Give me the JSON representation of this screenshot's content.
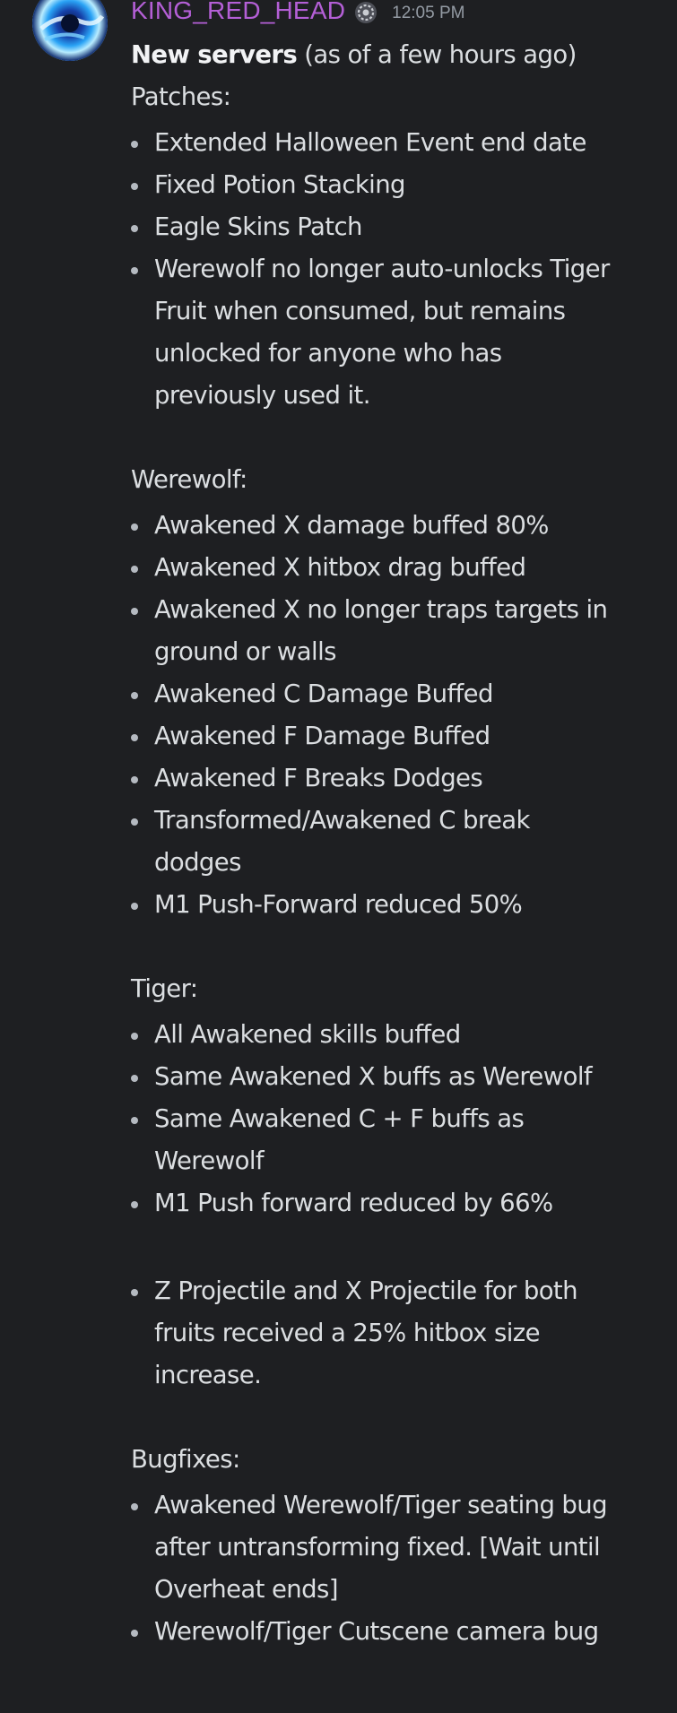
{
  "message": {
    "author": "KING_RED_HEAD",
    "time": "12:05 PM",
    "badge_icon": "gear-badge-icon",
    "author_color": "#b45fd6",
    "intro_bold": "New servers",
    "intro_rest": " (as of a few hours ago)",
    "sections": {
      "patches": {
        "heading": "Patches:",
        "items": [
          [
            "Extended Halloween Event end date"
          ],
          [
            "Fixed Potion Stacking"
          ],
          [
            "Eagle Skins Patch"
          ],
          [
            "Werewolf no longer auto-unlocks Tiger",
            "Fruit when consumed, but remains",
            "unlocked for anyone who has",
            "previously used it."
          ]
        ]
      },
      "werewolf": {
        "heading": "Werewolf:",
        "items": [
          [
            "Awakened X damage buffed 80%"
          ],
          [
            "Awakened X hitbox drag buffed"
          ],
          [
            "Awakened X no longer traps targets in",
            "ground or walls"
          ],
          [
            "Awakened C Damage Buffed"
          ],
          [
            "Awakened F Damage Buffed"
          ],
          [
            "Awakened F Breaks Dodges"
          ],
          [
            "Transformed/Awakened C break",
            "dodges"
          ],
          [
            "M1 Push-Forward reduced 50%"
          ]
        ]
      },
      "tiger": {
        "heading": "Tiger:",
        "items": [
          [
            "All Awakened skills buffed"
          ],
          [
            "Same Awakened X buffs as Werewolf"
          ],
          [
            "Same Awakened C + F buffs as",
            "Werewolf"
          ],
          [
            "M1 Push forward reduced by 66%"
          ]
        ]
      },
      "projectiles": {
        "items": [
          [
            "Z Projectile and X Projectile for both",
            "fruits received a 25% hitbox size",
            "increase."
          ]
        ]
      },
      "bugfixes": {
        "heading": "Bugfixes:",
        "items": [
          [
            "Awakened Werewolf/Tiger seating bug",
            "after untransforming fixed. [Wait until",
            "Overheat ends]"
          ],
          [
            "Werewolf/Tiger Cutscene camera bug"
          ]
        ]
      }
    }
  }
}
